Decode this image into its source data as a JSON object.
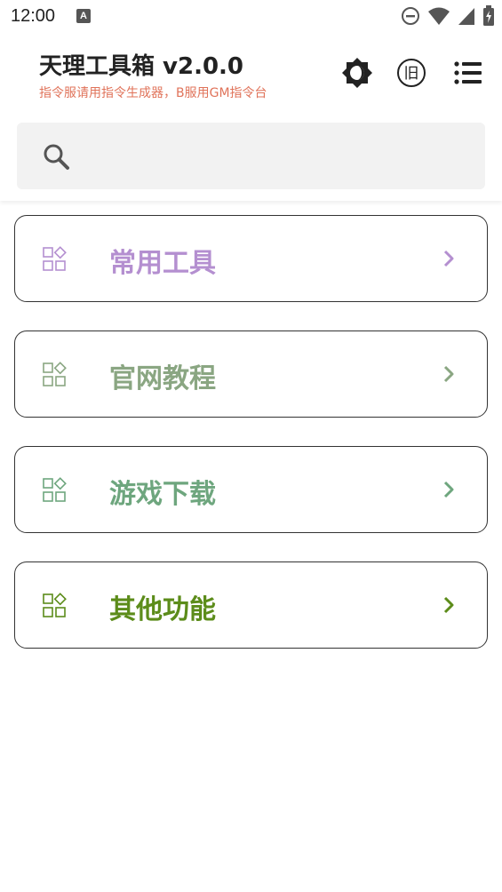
{
  "status_bar": {
    "time": "12:00",
    "notification_badge": "A"
  },
  "header": {
    "title": "天理工具箱 v2.0.0",
    "subtitle": "指令服请用指令生成器，B服用GM指令台",
    "old_version_label": "旧",
    "theme_icon": "brightness-icon",
    "menu_icon": "list-icon"
  },
  "search": {
    "placeholder": "",
    "value": ""
  },
  "menu_cards": [
    {
      "label": "常用工具",
      "color": "#b48fd0"
    },
    {
      "label": "官网教程",
      "color": "#8aa682"
    },
    {
      "label": "游戏下载",
      "color": "#6ea67e"
    },
    {
      "label": "其他功能",
      "color": "#5c8c1a"
    }
  ],
  "colors": {
    "subtitle": "#e0735a",
    "search_bg": "#f2f2f2",
    "card_border": "#333333"
  }
}
